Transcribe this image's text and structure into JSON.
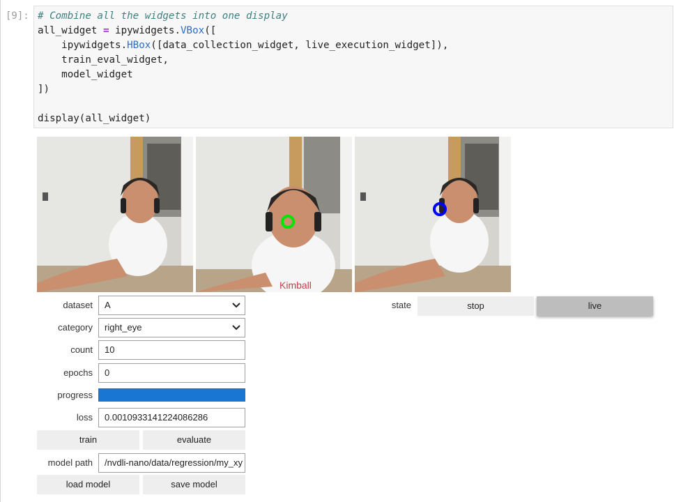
{
  "cell": {
    "prompt": "[9]:",
    "code": {
      "line1": "# Combine all the widgets into one display",
      "line2_a": "all_widget ",
      "line2_op": "=",
      "line2_b": " ipywidgets.",
      "line2_cls": "VBox",
      "line2_c": "([",
      "line3_a": "    ipywidgets.",
      "line3_cls": "HBox",
      "line3_b": "([data_collection_widget, live_execution_widget]),",
      "line4": "    train_eval_widget,",
      "line5": "    model_widget",
      "line6": "])",
      "line8": "display(all_widget)"
    }
  },
  "images": [
    {
      "name": "camera-feed-data-collection",
      "marker": "none"
    },
    {
      "name": "camera-feed-annotated",
      "marker": "green-circle",
      "marker_color": "#00e600"
    },
    {
      "name": "camera-feed-live-prediction",
      "marker": "blue-circle",
      "marker_color": "#0000ff"
    }
  ],
  "data_collection": {
    "dataset_label": "dataset",
    "dataset_value": "A",
    "category_label": "category",
    "category_value": "right_eye",
    "count_label": "count",
    "count_value": "10"
  },
  "train_eval": {
    "epochs_label": "epochs",
    "epochs_value": "0",
    "progress_label": "progress",
    "progress_fraction": 1.0,
    "progress_color": "#1976d2",
    "loss_label": "loss",
    "loss_value": "0.0010933141224086286",
    "train_label": "train",
    "evaluate_label": "evaluate"
  },
  "model": {
    "path_label": "model path",
    "path_value": "/nvdli-nano/data/regression/my_xy",
    "load_label": "load model",
    "save_label": "save model"
  },
  "live_execution": {
    "state_label": "state",
    "stop_label": "stop",
    "live_label": "live",
    "selected": "live"
  }
}
